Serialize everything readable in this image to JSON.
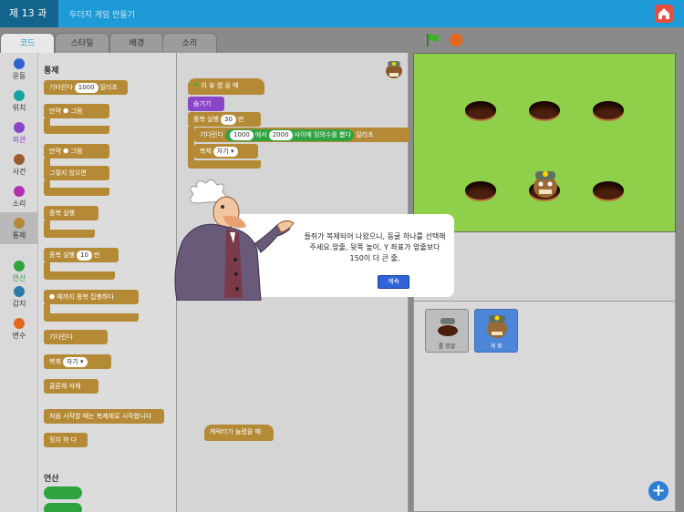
{
  "header": {
    "lesson": "제 13 과",
    "subtitle": "두더지 게임 만들기"
  },
  "tabs": [
    {
      "label": "코드",
      "active": true
    },
    {
      "label": "스타일"
    },
    {
      "label": "배경"
    },
    {
      "label": "소리"
    }
  ],
  "categories": [
    {
      "label": "운동",
      "color": "#2f64d0"
    },
    {
      "label": "위치",
      "color": "#1aa3a3"
    },
    {
      "label": "외관",
      "color": "#8a45c8"
    },
    {
      "label": "사건",
      "color": "#9a5c2a"
    },
    {
      "label": "소리",
      "color": "#b22fb0"
    },
    {
      "label": "통제",
      "color": "#b5873a",
      "active": true
    },
    {
      "label": "연산",
      "color": "#2ea340"
    },
    {
      "label": "감지",
      "color": "#2b7aa8"
    },
    {
      "label": "변수",
      "color": "#e2691e"
    }
  ],
  "palette": {
    "section": "통제",
    "wait": "기다린다",
    "wait_val": "1000",
    "wait_unit": "밀리초",
    "if": "만약",
    "then": "그럼",
    "else": "그렇지 않으면",
    "forever": "종복 실행",
    "repeat": "종복 실행",
    "repeat_val": "10",
    "repeat_unit": "번",
    "repeat_until": "때까지 종복 집행하다",
    "wait_until": "기다린다",
    "clone": "복제",
    "clone_val": "자기",
    "delete_clone": "클론체 삭제",
    "when_clone": "처음 시작할 때는 복제체로 시작합니다",
    "stop": "정지 하 다",
    "section2": "연산"
  },
  "script": {
    "when_flag": "이 놓 렸 을 때",
    "hide": "숨기기",
    "repeat": "중복 실행",
    "repeat_val": "30",
    "repeat_unit": "번",
    "wait": "기다린다",
    "rand_from": "1000",
    "rand_to_label": "에서",
    "rand_to": "2000",
    "rand_tail": "사이에 임의수를 뽑다",
    "wait_unit": "밀리초",
    "clone": "복제",
    "clone_val": "자기",
    "when_clicked": "캐릭터가 눌렸을 때"
  },
  "sprites": [
    {
      "label": "를 망굴"
    },
    {
      "label": "게 쥐",
      "selected": true
    }
  ],
  "dialog": {
    "text": "들쥐가 복제되어 나왔으니, 동굴 하나를 선택해 주세요.앞줄, 뒷쪽 높이, Y 좌표가 앞줄보다 150이 더 큰 줄,",
    "button": "계속"
  }
}
